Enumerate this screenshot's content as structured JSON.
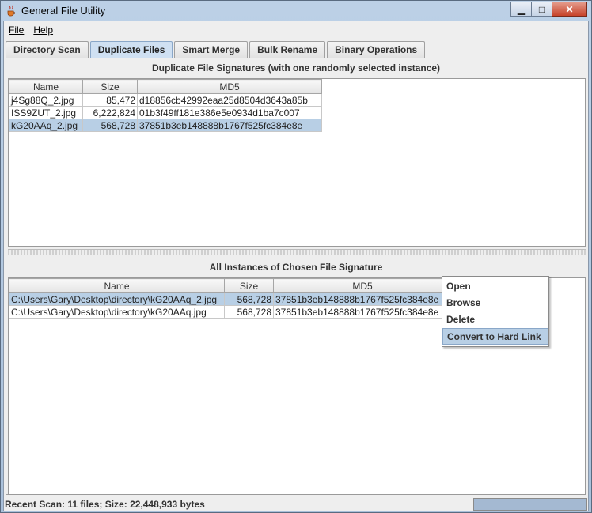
{
  "window": {
    "title": "General File Utility",
    "minimize_glyph": "▁",
    "maximize_glyph": "□",
    "close_glyph": "✕"
  },
  "menu": {
    "file": "File",
    "help": "Help"
  },
  "tabs": [
    {
      "label": "Directory Scan",
      "active": false
    },
    {
      "label": "Duplicate Files",
      "active": true
    },
    {
      "label": "Smart Merge",
      "active": false
    },
    {
      "label": "Bulk Rename",
      "active": false
    },
    {
      "label": "Binary Operations",
      "active": false
    }
  ],
  "signatures": {
    "title": "Duplicate File Signatures (with one randomly selected instance)",
    "columns": [
      "Name",
      "Size",
      "MD5"
    ],
    "rows": [
      {
        "name": "j4Sg88Q_2.jpg",
        "size": "85,472",
        "md5": "d18856cb42992eaa25d8504d3643a85b",
        "selected": false
      },
      {
        "name": "ISS9ZUT_2.jpg",
        "size": "6,222,824",
        "md5": "01b3f49ff181e386e5e0934d1ba7c007",
        "selected": false
      },
      {
        "name": "kG20AAq_2.jpg",
        "size": "568,728",
        "md5": "37851b3eb148888b1767f525fc384e8e",
        "selected": true
      }
    ]
  },
  "instances": {
    "title": "All Instances of Chosen File Signature",
    "columns": [
      "Name",
      "Size",
      "MD5"
    ],
    "rows": [
      {
        "name": "C:\\Users\\Gary\\Desktop\\directory\\kG20AAq_2.jpg",
        "size": "568,728",
        "md5": "37851b3eb148888b1767f525fc384e8e",
        "selected": true
      },
      {
        "name": "C:\\Users\\Gary\\Desktop\\directory\\kG20AAq.jpg",
        "size": "568,728",
        "md5": "37851b3eb148888b1767f525fc384e8e",
        "selected": false
      }
    ]
  },
  "context_menu": {
    "items": [
      "Open",
      "Browse",
      "Delete",
      "Convert to Hard Link"
    ],
    "highlighted_index": 3
  },
  "status": {
    "text": "Recent Scan: 11 files; Size: 22,448,933 bytes",
    "progress": 1.0
  },
  "colors": {
    "selection": "#b8cfe5",
    "active_tab": "#cfe0f2"
  }
}
